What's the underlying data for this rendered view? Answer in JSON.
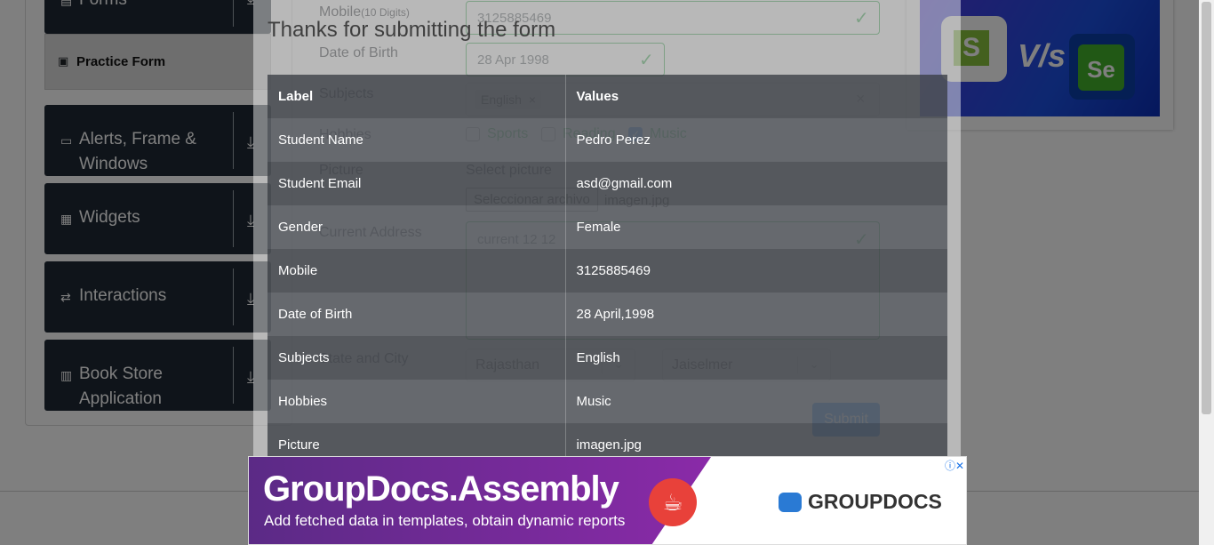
{
  "sidebar": {
    "forms_label": "Forms",
    "practice_form_label": "Practice Form",
    "items": [
      {
        "label": "Alerts, Frame & Windows",
        "icon": "window-icon"
      },
      {
        "label": "Widgets",
        "icon": "widgets-icon"
      },
      {
        "label": "Interactions",
        "icon": "interactions-icon"
      },
      {
        "label": "Book Store Application",
        "icon": "books-icon"
      }
    ]
  },
  "form": {
    "mobile_label": "Mobile",
    "mobile_hint": "(10 Digits)",
    "mobile_value": "3125885469",
    "dob_label": "Date of Birth",
    "dob_value": "28 Apr 1998",
    "subjects_label": "Subjects",
    "subject_chip": "English",
    "hobbies_label": "Hobbies",
    "hobbies": [
      {
        "label": "Sports",
        "checked": false
      },
      {
        "label": "Reading",
        "checked": false
      },
      {
        "label": "Music",
        "checked": true
      }
    ],
    "picture_label": "Picture",
    "select_picture_label": "Select picture",
    "file_button_label": "Seleccionar archivo",
    "file_name": "imagen.jpg",
    "address_label": "Current Address",
    "address_value": "current 12 12",
    "state_city_label": "State and City",
    "state_value": "Rajasthan",
    "city_value": "Jaiselmer",
    "submit_label": "Submit"
  },
  "modal": {
    "title": "Thanks for submitting the form",
    "header": {
      "label": "Label",
      "values": "Values"
    },
    "rows": [
      {
        "label": "Student Name",
        "value": "Pedro Perez"
      },
      {
        "label": "Student Email",
        "value": "asd@gmail.com"
      },
      {
        "label": "Gender",
        "value": "Female"
      },
      {
        "label": "Mobile",
        "value": "3125885469"
      },
      {
        "label": "Date of Birth",
        "value": "28 April,1998"
      },
      {
        "label": "Subjects",
        "value": "English"
      },
      {
        "label": "Hobbies",
        "value": "Music"
      },
      {
        "label": "Picture",
        "value": "imagen.jpg"
      }
    ]
  },
  "ad": {
    "headline": "GroupDocs.Assembly",
    "subline": "Add fetched data in templates, obtain dynamic reports",
    "brand": "GROUPDOCS",
    "ad_choices": "ⓘ✕"
  },
  "banner": {
    "vs_text": "V/s",
    "left_logo": "S",
    "right_logo": "Se"
  },
  "colors": {
    "valid": "#28a745",
    "primary": "#007bff",
    "sidebar_card": "#1f2934"
  }
}
